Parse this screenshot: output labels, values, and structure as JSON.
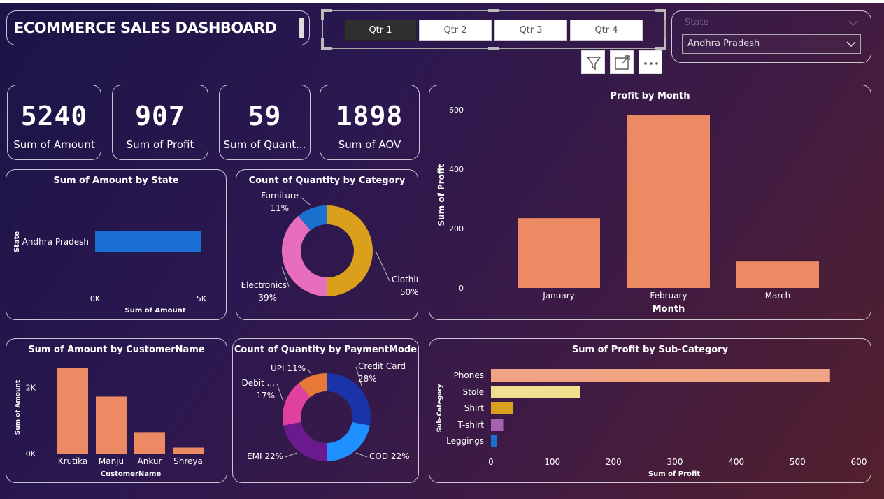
{
  "header": {
    "title": "ECOMMERCE SALES DASHBOARD"
  },
  "quarter_slicer": {
    "buttons": [
      "Qtr 1",
      "Qtr 2",
      "Qtr 3",
      "Qtr 4"
    ],
    "selected": "Qtr 1"
  },
  "state_slicer": {
    "label": "State",
    "selected": "Andhra Pradesh"
  },
  "toolbar": {
    "icons": [
      "filter-icon",
      "focus-mode-icon",
      "more-options-icon"
    ]
  },
  "kpis": [
    {
      "value": "5240",
      "label": "Sum of Amount"
    },
    {
      "value": "907",
      "label": "Sum of Profit"
    },
    {
      "value": "59",
      "label": "Sum of Quant..."
    },
    {
      "value": "1898",
      "label": "Sum of AOV"
    }
  ],
  "colors": {
    "bar_orange": "#ec8a63",
    "bar_blue": "#1a6fd4",
    "clothing": "#daa01c",
    "electronics": "#e76dbf",
    "furniture": "#1c71cf"
  },
  "chart_data": [
    {
      "id": "amount_by_state",
      "type": "bar",
      "orientation": "horizontal",
      "title": "Sum of Amount by State",
      "xlabel": "Sum of Amount",
      "ylabel": "State",
      "categories": [
        "Andhra Pradesh"
      ],
      "values": [
        5240
      ],
      "xlim": [
        0,
        5240
      ],
      "xticks": [
        "0K",
        "5K"
      ]
    },
    {
      "id": "quantity_by_category",
      "type": "pie",
      "donut": true,
      "title": "Count of Quantity by Category",
      "categories": [
        "Clothing",
        "Electronics",
        "Furniture"
      ],
      "values": [
        50,
        39,
        11
      ],
      "labels": [
        "50%",
        "39%",
        "11%"
      ],
      "colors": [
        "#daa01c",
        "#e76dbf",
        "#1c71cf"
      ]
    },
    {
      "id": "profit_by_month",
      "type": "bar",
      "title": "Profit by Month",
      "xlabel": "Month",
      "ylabel": "Sum of Profit",
      "categories": [
        "January",
        "February",
        "March"
      ],
      "values": [
        235,
        583,
        89
      ],
      "ylim": [
        0,
        600
      ],
      "yticks": [
        0,
        200,
        400,
        600
      ],
      "color": "#ec8a63"
    },
    {
      "id": "amount_by_customer",
      "type": "bar",
      "title": "Sum of Amount by CustomerName",
      "xlabel": "CustomerName",
      "ylabel": "Sum of Amount",
      "categories": [
        "Krutika",
        "Manju",
        "Ankur",
        "Shreya"
      ],
      "values": [
        2600,
        1730,
        650,
        180
      ],
      "ylim": [
        0,
        2800
      ],
      "yticks": [
        0,
        2000
      ],
      "ytick_labels": [
        "0K",
        "2K"
      ],
      "color": "#ec8a63"
    },
    {
      "id": "quantity_by_paymentmode",
      "type": "pie",
      "donut": true,
      "title": "Count of Quantity by PaymentMode",
      "categories": [
        "Credit Card",
        "COD",
        "EMI",
        "Debit ...",
        "UPI"
      ],
      "values": [
        28,
        22,
        22,
        17,
        11
      ],
      "labels": [
        "28%",
        "22%",
        "22%",
        "17%",
        "11%"
      ],
      "colors": [
        "#1a34a8",
        "#1e90ff",
        "#6a1a8c",
        "#e040a0",
        "#e8783a"
      ]
    },
    {
      "id": "profit_by_subcategory",
      "type": "bar",
      "orientation": "horizontal",
      "title": "Sum of Profit by Sub-Category",
      "xlabel": "Sum of Profit",
      "ylabel": "Sub-Category",
      "categories": [
        "Phones",
        "Stole",
        "Shirt",
        "T-shirt",
        "Leggings"
      ],
      "values": [
        553,
        146,
        36,
        20,
        10
      ],
      "xlim": [
        0,
        600
      ],
      "xticks": [
        0,
        100,
        200,
        300,
        400,
        500,
        600
      ],
      "colors": [
        "#f0a484",
        "#efe08f",
        "#daa01c",
        "#a562b3",
        "#1a6fd4"
      ]
    }
  ]
}
